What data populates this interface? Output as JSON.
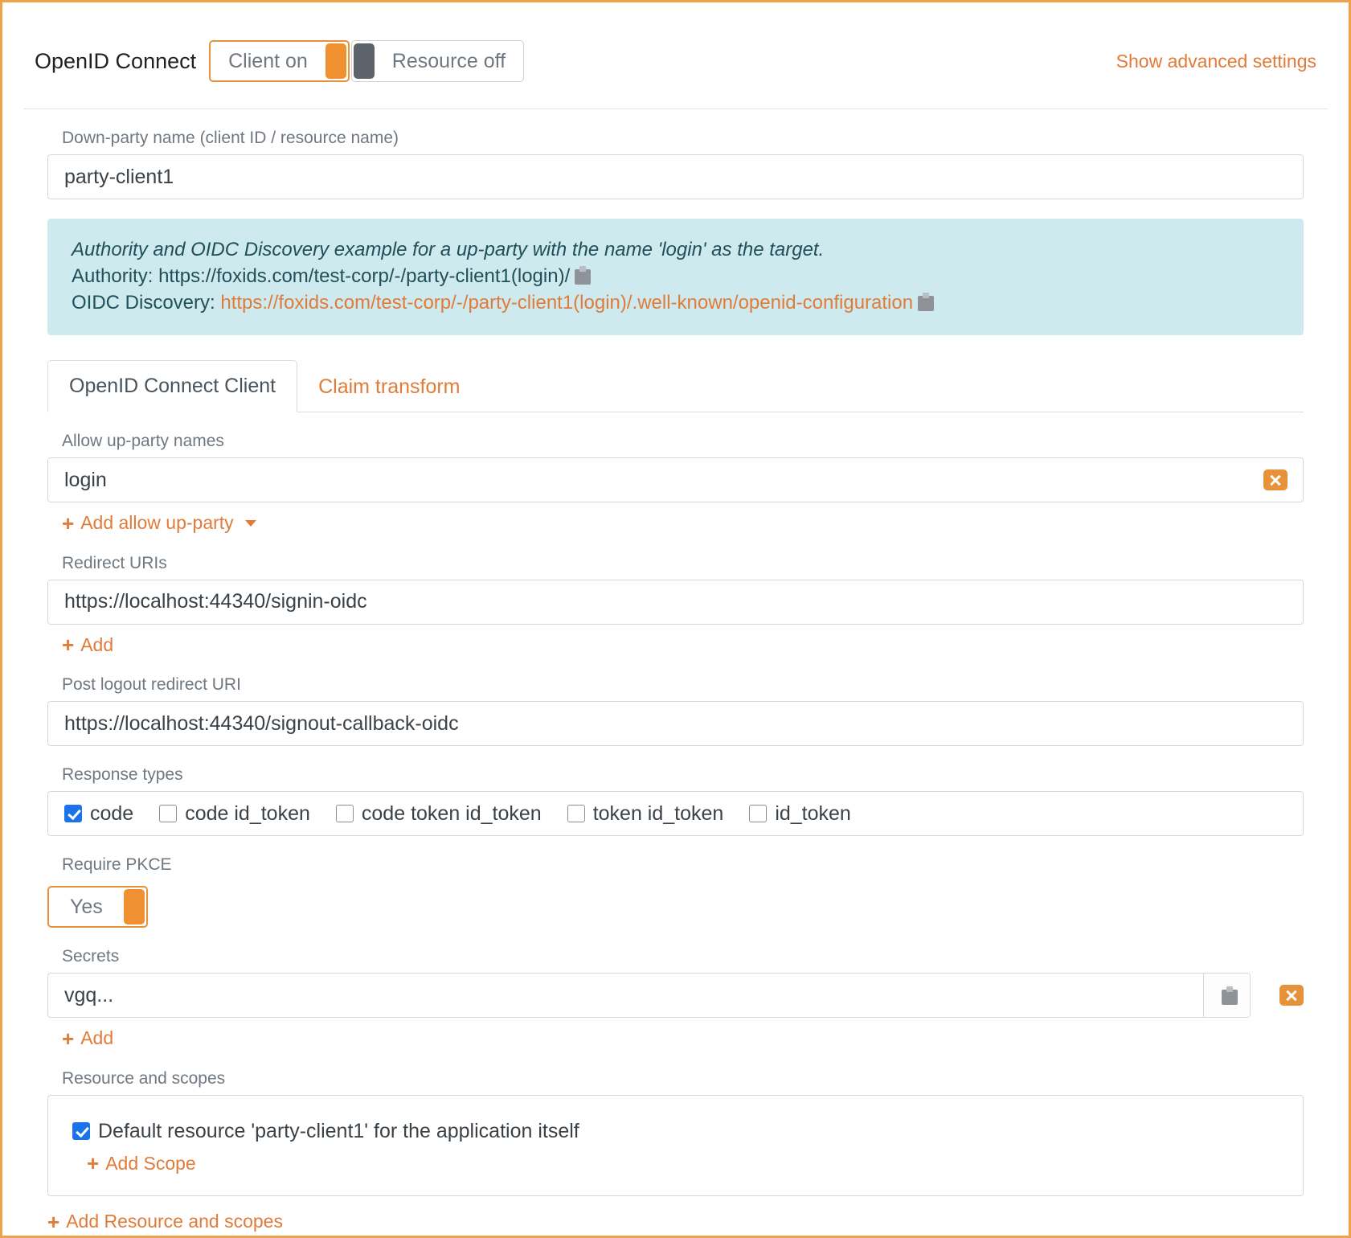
{
  "header": {
    "title": "OpenID Connect",
    "client_toggle": {
      "label": "Client on",
      "state": "on"
    },
    "resource_toggle": {
      "label": "Resource off",
      "state": "off"
    },
    "advanced_link": "Show advanced settings"
  },
  "down_party": {
    "label": "Down-party name (client ID / resource name)",
    "value": "party-client1"
  },
  "alert": {
    "note": "Authority and OIDC Discovery example for a up-party with the name 'login' as the target.",
    "authority_label": "Authority:",
    "authority_url": "https://foxids.com/test-corp/-/party-client1(login)/",
    "discovery_label": "OIDC Discovery:",
    "discovery_url": "https://foxids.com/test-corp/-/party-client1(login)/.well-known/openid-configuration",
    "copy_icon": "clipboard-icon"
  },
  "tabs": [
    {
      "label": "OpenID Connect Client",
      "active": true
    },
    {
      "label": "Claim transform",
      "active": false
    }
  ],
  "allow_up_party": {
    "label": "Allow up-party names",
    "value": "login",
    "clear_icon": "clear-icon",
    "add_label": "Add allow up-party"
  },
  "redirect_uris": {
    "label": "Redirect URIs",
    "value": "https://localhost:44340/signin-oidc",
    "add_label": "Add"
  },
  "post_logout": {
    "label": "Post logout redirect URI",
    "value": "https://localhost:44340/signout-callback-oidc"
  },
  "response_types": {
    "label": "Response types",
    "options": [
      {
        "label": "code",
        "checked": true
      },
      {
        "label": "code id_token",
        "checked": false
      },
      {
        "label": "code token id_token",
        "checked": false
      },
      {
        "label": "token id_token",
        "checked": false
      },
      {
        "label": "id_token",
        "checked": false
      }
    ]
  },
  "require_pkce": {
    "label": "Require PKCE",
    "value": "Yes",
    "state": "on"
  },
  "secrets": {
    "label": "Secrets",
    "value": "vgq...",
    "copy_icon": "clipboard-icon",
    "delete_icon": "clear-icon",
    "add_label": "Add"
  },
  "resource_scopes": {
    "label": "Resource and scopes",
    "default_resource": {
      "label": "Default resource 'party-client1' for the application itself",
      "checked": true
    },
    "add_scope_label": "Add Scope",
    "add_resource_label": "Add Resource and scopes"
  }
}
